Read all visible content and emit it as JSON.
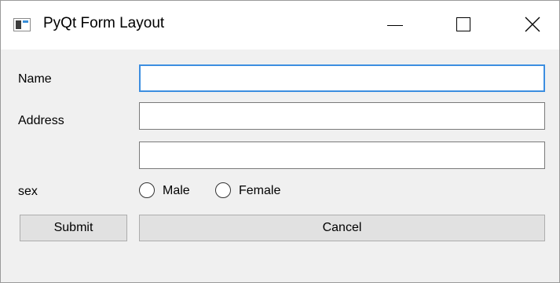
{
  "window": {
    "title": "PyQt Form Layout",
    "controls": [
      "minimize-icon",
      "maximize-icon",
      "close-icon"
    ]
  },
  "form": {
    "name_label": "Name",
    "name_value": "",
    "address_label": "Address",
    "address_line1_value": "",
    "address_line2_value": "",
    "sex_label": "sex",
    "sex_options": [
      "Male",
      "Female"
    ],
    "sex_selected": null
  },
  "buttons": {
    "submit_label": "Submit",
    "cancel_label": "Cancel"
  },
  "colors": {
    "focus_border": "#3c8ee0",
    "window_bg": "#f0f0f0",
    "button_bg": "#e1e1e1"
  }
}
